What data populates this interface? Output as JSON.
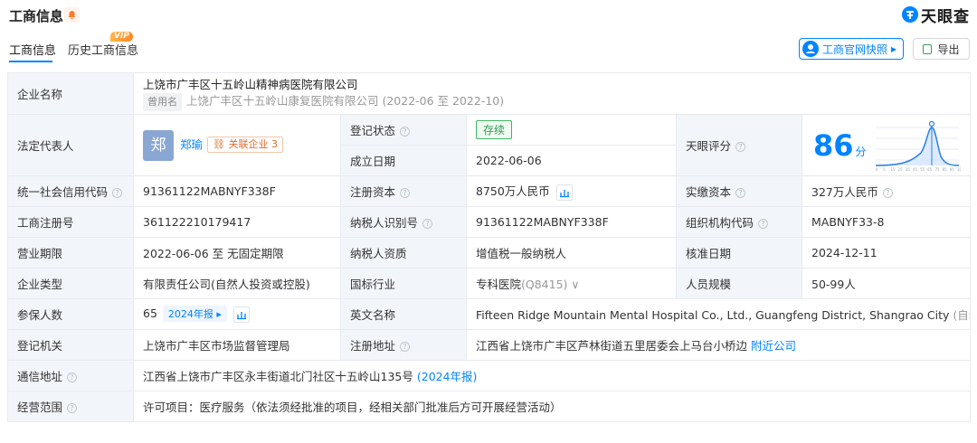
{
  "header": {
    "title": "工商信息",
    "logo_text": "天眼查"
  },
  "tabs": [
    {
      "label": "工商信息"
    },
    {
      "label": "历史工商信息",
      "badge": "VIP"
    }
  ],
  "actions": {
    "snapshot_label": "工商官网快照",
    "export_label": "导出"
  },
  "company": {
    "name_label": "企业名称",
    "name": "上饶市广丰区十五岭山精神病医院有限公司",
    "former_tag": "曾用名",
    "former_name": "上饶广丰区十五岭山康复医院有限公司 (2022-06 至 2022-10)",
    "legal_rep_label": "法定代表人",
    "legal_rep_avatar": "郑",
    "legal_rep_name": "郑瑜",
    "assoc_label": "关联企业",
    "assoc_count": "3",
    "reg_status_label": "登记状态",
    "reg_status": "存续",
    "est_date_label": "成立日期",
    "est_date": "2022-06-06",
    "score_label": "天眼评分",
    "score": "86",
    "score_unit": "分",
    "score_axis": [
      "0",
      "5",
      "15",
      "25",
      "35",
      "45",
      "55",
      "65",
      "75",
      "85",
      "95",
      "100"
    ],
    "credit_code_label": "统一社会信用代码",
    "credit_code": "91361122MABNYF338F",
    "reg_capital_label": "注册资本",
    "reg_capital": "8750万人民币",
    "paid_capital_label": "实缴资本",
    "paid_capital": "327万人民币",
    "reg_no_label": "工商注册号",
    "reg_no": "361122210179417",
    "taxpayer_id_label": "纳税人识别号",
    "taxpayer_id": "91361122MABNYF338F",
    "org_code_label": "组织机构代码",
    "org_code": "MABNYF33-8",
    "term_label": "营业期限",
    "term": "2022-06-06 至 无固定期限",
    "taxpayer_qual_label": "纳税人资质",
    "taxpayer_qual": "增值税一般纳税人",
    "approval_date_label": "核准日期",
    "approval_date": "2024-12-11",
    "type_label": "企业类型",
    "type": "有限责任公司(自然人投资或控股)",
    "industry_label": "国标行业",
    "industry": "专科医院",
    "industry_code": "(Q8415)",
    "staff_label": "人员规模",
    "staff": "50-99人",
    "insured_label": "参保人数",
    "insured": "65",
    "insured_year": "2024年报",
    "en_name_label": "英文名称",
    "en_name": "Fifteen Ridge Mountain Mental Hospital Co., Ltd., Guangfeng District, Shangrao City",
    "en_name_note": "(自动翻译)",
    "authority_label": "登记机关",
    "authority": "上饶市广丰区市场监督管理局",
    "reg_addr_label": "注册地址",
    "reg_addr": "江西省上饶市广丰区芦林街道五里居委会上马台小桥边",
    "nearby_link": "附近公司",
    "mail_addr_label": "通信地址",
    "mail_addr": "江西省上饶市广丰区永丰街道北门社区十五岭山135号",
    "mail_addr_year": "(2024年报)",
    "scope_label": "经营范围",
    "scope": "许可项目：医疗服务（依法须经批准的项目，经相关部门批准后方可开展经营活动）"
  },
  "colors": {
    "accent": "#0084ff",
    "label_bg": "#f2f5fa",
    "status_green": "#2f9e4e",
    "tag_orange": "#e06b2b"
  }
}
